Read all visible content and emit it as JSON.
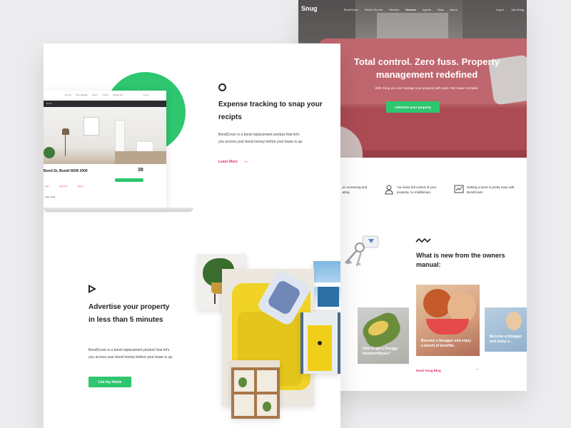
{
  "back_page": {
    "nav": {
      "logo": "Snug",
      "links": [
        "BondCover",
        "Rental Scores",
        "Renters",
        "Owners",
        "Agents",
        "Blog",
        "About"
      ],
      "active": "Owners",
      "login": "Log In",
      "join": "Join Snug"
    },
    "hero": {
      "title": "Total control. Zero fuss. Property management redefined",
      "subtitle": "With Snug you can manage your property with ease. We make it simpler.",
      "cta": "Advertise your property"
    },
    "features": [
      {
        "text": "...on screening and ...ating."
      },
      {
        "text": "You have full control of your property, no middleman."
      },
      {
        "text": "Getting a bond is pretty easy with BondCover"
      }
    ],
    "news": {
      "title": "What is new from the owners manual:",
      "cards": [
        {
          "caption": "How to get a Snuggy bondcertificate?"
        },
        {
          "caption": "Become a Snugger and enjoy a bunch of benefits."
        },
        {
          "caption": "Become a Snugger and enjoy a..."
        }
      ],
      "link": "Read Snug Blog",
      "arrow": "→"
    }
  },
  "front_page": {
    "laptop": {
      "nav": [
        "My Lists",
        "Team Manager",
        "Renters",
        "Owners",
        "Manage Site",
        "Log out"
      ],
      "bar_label": "Home",
      "address": "Bond St, Bondi NSW 2000",
      "price": "38",
      "mini_links": [
        "Save",
        "Share this",
        "Report"
      ],
      "apply": "Apply Listing"
    },
    "section1": {
      "title": "Expense tracking to snap your recipts",
      "body": "BondCover is a bond replacement product that let's you access your bond money before your lease is up.",
      "link": "Learn More",
      "arrow": "→"
    },
    "section2": {
      "title": "Advertise your property in less than 5 minutes",
      "body": "BondCover is a bond replacement product that let's you access your bond money before your lease is up.",
      "button": "List my Home"
    }
  },
  "colors": {
    "brand_green": "#2ec66f",
    "accent_pink": "#e6305c",
    "sofa_red": "#c3595f",
    "chair_yellow": "#f0d326"
  }
}
